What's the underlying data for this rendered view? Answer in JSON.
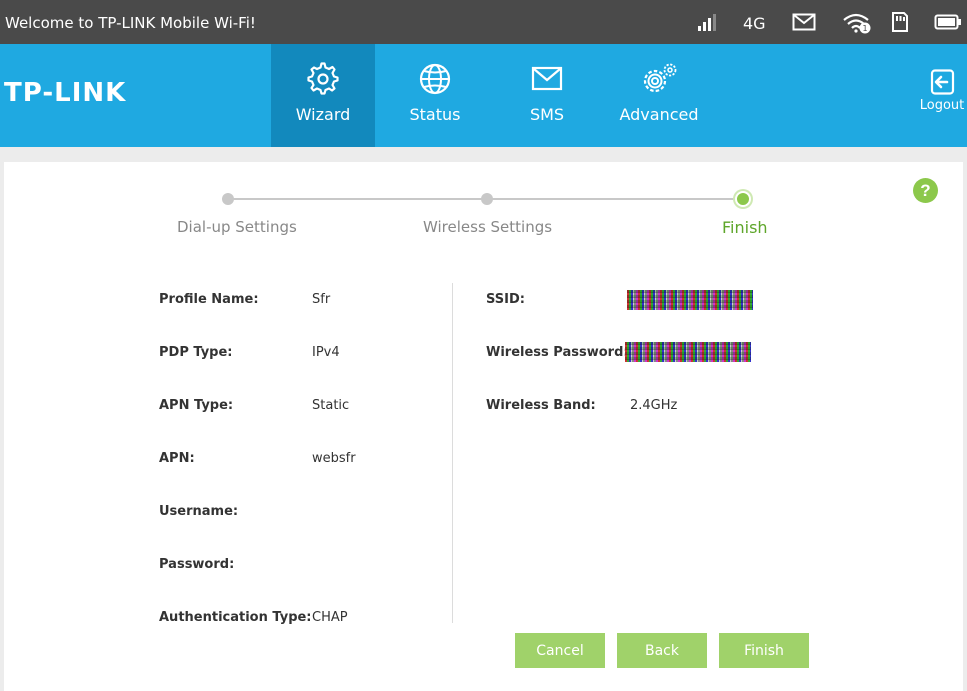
{
  "statusbar": {
    "welcome": "Welcome to TP-LINK Mobile Wi-Fi!",
    "network": "4G",
    "wifi_clients": "1",
    "icons": [
      "signal-icon",
      "mail-icon",
      "wifi-icon",
      "sim-card-icon",
      "battery-icon"
    ]
  },
  "header": {
    "logo": "TP-LINK",
    "nav": [
      {
        "label": "Wizard",
        "icon": "gear-icon",
        "active": true
      },
      {
        "label": "Status",
        "icon": "globe-icon"
      },
      {
        "label": "SMS",
        "icon": "envelope-icon"
      },
      {
        "label": "Advanced",
        "icon": "gears-icon"
      }
    ],
    "logout": "Logout"
  },
  "steps": [
    {
      "label": "Dial-up Settings"
    },
    {
      "label": "Wireless Settings"
    },
    {
      "label": "Finish",
      "current": true
    }
  ],
  "dialup": [
    {
      "label": "Profile Name:",
      "value": "Sfr"
    },
    {
      "label": "PDP Type:",
      "value": "IPv4"
    },
    {
      "label": "APN Type:",
      "value": "Static"
    },
    {
      "label": "APN:",
      "value": "websfr"
    },
    {
      "label": "Username:",
      "value": ""
    },
    {
      "label": "Password:",
      "value": ""
    },
    {
      "label": "Authentication Type:",
      "value": "CHAP"
    }
  ],
  "wireless": [
    {
      "label": "SSID:"
    },
    {
      "label": "Wireless Password:"
    },
    {
      "label": "Wireless Band:",
      "value": "2.4GHz"
    }
  ],
  "help": "?",
  "buttons": {
    "cancel": "Cancel",
    "back": "Back",
    "finish": "Finish"
  },
  "colors": {
    "nav_bg": "#1fa9e1",
    "nav_active": "#1289bd",
    "statusbar_bg": "#4a4a4a",
    "accent_green": "#8cc84b",
    "button_green": "#a0d26a"
  }
}
